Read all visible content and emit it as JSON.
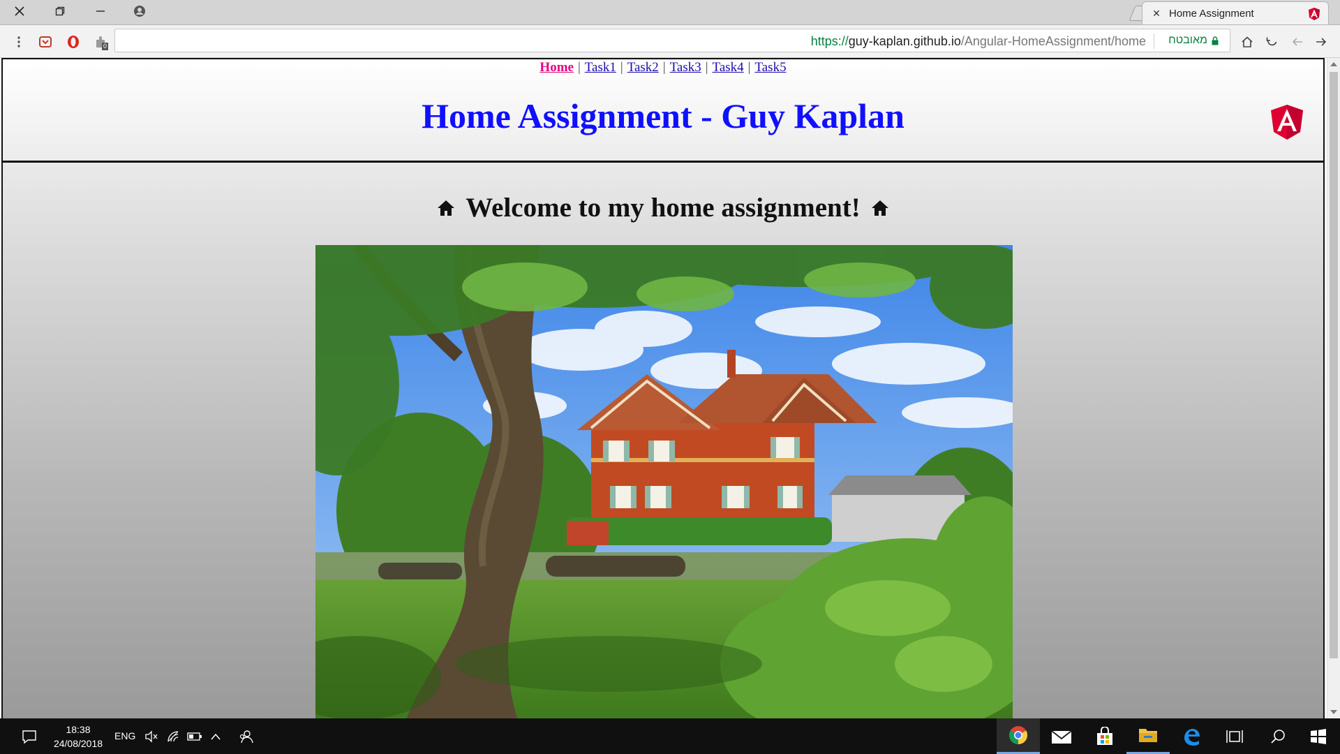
{
  "window": {
    "controls": [
      "close",
      "restore",
      "minimize",
      "account"
    ]
  },
  "tab": {
    "title": "Home Assignment"
  },
  "address_bar": {
    "url_scheme": "https://",
    "url_host": "guy-kaplan.github.io",
    "url_path": "/Angular-HomeAssignment/home",
    "security_label": "מאובטח",
    "extension_badge": "0"
  },
  "site": {
    "nav": {
      "items": [
        {
          "label": "Home",
          "active": true
        },
        {
          "label": "Task1"
        },
        {
          "label": "Task2"
        },
        {
          "label": "Task3"
        },
        {
          "label": "Task4"
        },
        {
          "label": "Task5"
        }
      ],
      "separator": "|"
    },
    "title": "Home Assignment - Guy Kaplan",
    "welcome": "Welcome to my home assignment!",
    "colors": {
      "title": "#1010ff",
      "nav_active": "#e6007e",
      "nav_link": "#1a0dab"
    }
  },
  "taskbar": {
    "time": "18:38",
    "date": "24/08/2018",
    "language": "ENG",
    "apps": [
      {
        "name": "chrome-icon",
        "state": "active"
      },
      {
        "name": "mail-icon"
      },
      {
        "name": "store-icon"
      },
      {
        "name": "file-explorer-icon",
        "state": "open"
      },
      {
        "name": "edge-icon"
      },
      {
        "name": "task-view-icon"
      },
      {
        "name": "search-icon"
      },
      {
        "name": "start-icon"
      }
    ]
  }
}
